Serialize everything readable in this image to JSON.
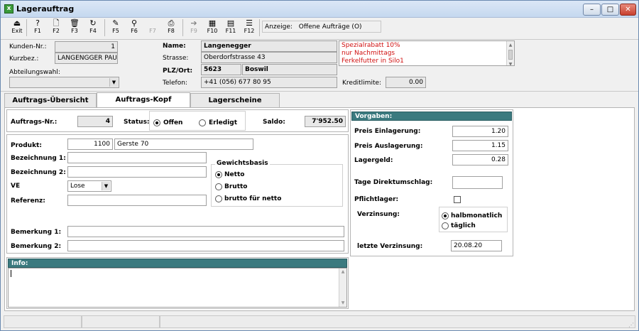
{
  "window": {
    "title": "Lagerauftrag",
    "min": "–",
    "max": "□",
    "close": "✕"
  },
  "toolbar": [
    {
      "label": "Exit",
      "icon": "exit-icon",
      "glyph": "⏏",
      "enabled": true
    },
    {
      "label": "F1",
      "icon": "help-icon",
      "glyph": "?",
      "enabled": true
    },
    {
      "label": "F2",
      "icon": "new-document-icon",
      "glyph": "🗋",
      "enabled": true
    },
    {
      "label": "F3",
      "icon": "trash-icon",
      "glyph": "🗑",
      "enabled": true
    },
    {
      "label": "F4",
      "icon": "refresh-icon",
      "glyph": "↻",
      "enabled": true
    },
    {
      "label": "F5",
      "icon": "edit-list-icon",
      "glyph": "✎",
      "enabled": true
    },
    {
      "label": "F6",
      "icon": "search-icon",
      "glyph": "⚲",
      "enabled": true
    },
    {
      "label": "F7",
      "icon": "blank-icon",
      "glyph": "",
      "enabled": false
    },
    {
      "label": "F8",
      "icon": "print-icon",
      "glyph": "⎙",
      "enabled": true
    },
    {
      "label": "F9",
      "icon": "forward-icon",
      "glyph": "➔",
      "enabled": false
    },
    {
      "label": "F10",
      "icon": "calculator-icon",
      "glyph": "▦",
      "enabled": true
    },
    {
      "label": "F11",
      "icon": "report-icon",
      "glyph": "▤",
      "enabled": true
    },
    {
      "label": "F12",
      "icon": "notes-icon",
      "glyph": "☰",
      "enabled": true
    }
  ],
  "anzeige": {
    "label": "Anzeige:",
    "value": "Offene Aufträge (O)"
  },
  "customer": {
    "kunden_nr_label": "Kunden-Nr.:",
    "kunden_nr": "1",
    "kurzbez_label": "Kurzbez.:",
    "kurzbez": "LANGENGGER PAU",
    "abteilung_label": "Abteilungswahl:",
    "abteilung": "",
    "name_label": "Name:",
    "name": "Langenegger",
    "strasse_label": "Strasse:",
    "strasse": "Oberdorfstrasse 43",
    "plz_label": "PLZ/Ort:",
    "plz": "5623",
    "ort": "Boswil",
    "telefon_label": "Telefon:",
    "telefon": "+41 (056) 677 80 95",
    "notes": [
      "Spezialrabatt 10%",
      "nur Nachmittags",
      "Ferkelfutter in Silo1"
    ],
    "kreditlimite_label": "Kreditlimite:",
    "kreditlimite": "0.00"
  },
  "tabs": [
    {
      "label": "Auftrags-Übersicht",
      "active": false
    },
    {
      "label": "Auftrags-Kopf",
      "active": true
    },
    {
      "label": "Lagerscheine",
      "active": false
    }
  ],
  "order": {
    "auftrags_nr_label": "Auftrags-Nr.:",
    "auftrags_nr": "4",
    "status_label": "Status:",
    "status_offen": "Offen",
    "status_erledigt": "Erledigt",
    "saldo_label": "Saldo:",
    "saldo": "7'952.50"
  },
  "product": {
    "produkt_label": "Produkt:",
    "produkt_nr": "1100",
    "produkt_name": "Gerste 70",
    "bez1_label": "Bezeichnung 1:",
    "bez1": "",
    "bez2_label": "Bezeichnung 2:",
    "bez2": "",
    "ve_label": "VE",
    "ve": "Lose",
    "referenz_label": "Referenz:",
    "referenz": "",
    "gewicht_title": "Gewichtsbasis",
    "gewicht_options": [
      "Netto",
      "Brutto",
      "brutto für netto"
    ],
    "bem1_label": "Bemerkung 1:",
    "bem1": "",
    "bem2_label": "Bemerkung 2:",
    "bem2": ""
  },
  "vorgaben": {
    "title": "Vorgaben:",
    "einlagerung_label": "Preis Einlagerung:",
    "einlagerung": "1.20",
    "auslagerung_label": "Preis Auslagerung:",
    "auslagerung": "1.15",
    "lagergeld_label": "Lagergeld:",
    "lagergeld": "0.28",
    "tage_label": "Tage Direktumschlag:",
    "tage": "",
    "pflicht_label": "Pflichtlager:",
    "verzinsung_label": "Verzinsung:",
    "verz_opt1": "halbmonatlich",
    "verz_opt2": "täglich",
    "letzte_label": "letzte Verzinsung:",
    "letzte": "20.08.20"
  },
  "info": {
    "title": "Info:",
    "text": ""
  }
}
